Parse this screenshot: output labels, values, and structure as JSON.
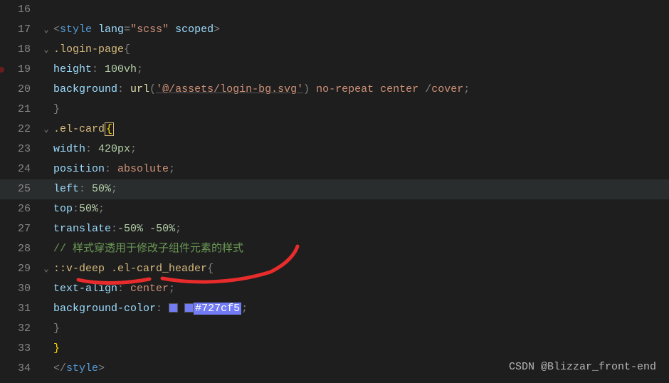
{
  "editor": {
    "lines": [
      {
        "num": 16,
        "fold": "",
        "tokens": []
      },
      {
        "num": 17,
        "fold": "v",
        "tokens": [
          {
            "t": "<",
            "c": "punct"
          },
          {
            "t": "style",
            "c": "tag"
          },
          {
            "t": " ",
            "c": ""
          },
          {
            "t": "lang",
            "c": "attr"
          },
          {
            "t": "=",
            "c": "punct"
          },
          {
            "t": "\"scss\"",
            "c": "str"
          },
          {
            "t": " ",
            "c": ""
          },
          {
            "t": "scoped",
            "c": "attr"
          },
          {
            "t": ">",
            "c": "punct"
          }
        ]
      },
      {
        "num": 18,
        "fold": "v",
        "indent": 1,
        "tokens": [
          {
            "t": ".login-page",
            "c": "sel"
          },
          {
            "t": "{",
            "c": "punct"
          }
        ]
      },
      {
        "num": 19,
        "fold": "",
        "indent": 2,
        "tokens": [
          {
            "t": "height",
            "c": "prop"
          },
          {
            "t": ": ",
            "c": "punct"
          },
          {
            "t": "100vh",
            "c": "num"
          },
          {
            "t": ";",
            "c": "punct"
          }
        ]
      },
      {
        "num": 20,
        "fold": "",
        "indent": 2,
        "tokens": [
          {
            "t": "background",
            "c": "prop"
          },
          {
            "t": ": ",
            "c": "punct"
          },
          {
            "t": "url",
            "c": "func"
          },
          {
            "t": "(",
            "c": "punct"
          },
          {
            "t": "'@/assets/login-bg.svg'",
            "c": "str-u"
          },
          {
            "t": ")",
            "c": "punct"
          },
          {
            "t": " ",
            "c": ""
          },
          {
            "t": "no-repeat",
            "c": "kw"
          },
          {
            "t": " ",
            "c": ""
          },
          {
            "t": "center",
            "c": "kw"
          },
          {
            "t": " /",
            "c": "punct"
          },
          {
            "t": "cover",
            "c": "kw"
          },
          {
            "t": ";",
            "c": "punct"
          }
        ]
      },
      {
        "num": 21,
        "fold": "",
        "indent": 1,
        "tokens": [
          {
            "t": "}",
            "c": "punct"
          }
        ]
      },
      {
        "num": 22,
        "fold": "v",
        "indent": 1,
        "tokens": [
          {
            "t": ".el-card",
            "c": "sel"
          },
          {
            "t": "{",
            "c": "cursor-box"
          }
        ]
      },
      {
        "num": 23,
        "fold": "",
        "indent": 2,
        "tokens": [
          {
            "t": "width",
            "c": "prop"
          },
          {
            "t": ": ",
            "c": "punct"
          },
          {
            "t": "420px",
            "c": "num"
          },
          {
            "t": ";",
            "c": "punct"
          }
        ]
      },
      {
        "num": 24,
        "fold": "",
        "indent": 2,
        "tokens": [
          {
            "t": "position",
            "c": "prop"
          },
          {
            "t": ": ",
            "c": "punct"
          },
          {
            "t": "absolute",
            "c": "kw"
          },
          {
            "t": ";",
            "c": "punct"
          }
        ]
      },
      {
        "num": 25,
        "fold": "",
        "indent": 2,
        "current": true,
        "tokens": [
          {
            "t": "left",
            "c": "prop"
          },
          {
            "t": ": ",
            "c": "punct"
          },
          {
            "t": "50%",
            "c": "num"
          },
          {
            "t": ";",
            "c": "punct"
          }
        ]
      },
      {
        "num": 26,
        "fold": "",
        "indent": 2,
        "tokens": [
          {
            "t": "top",
            "c": "prop"
          },
          {
            "t": ":",
            "c": "punct"
          },
          {
            "t": "50%",
            "c": "num"
          },
          {
            "t": ";",
            "c": "punct"
          }
        ]
      },
      {
        "num": 27,
        "fold": "",
        "indent": 2,
        "tokens": [
          {
            "t": "translate",
            "c": "prop"
          },
          {
            "t": ":",
            "c": "punct"
          },
          {
            "t": "-50%",
            "c": "num"
          },
          {
            "t": " ",
            "c": ""
          },
          {
            "t": "-50%",
            "c": "num"
          },
          {
            "t": ";",
            "c": "punct"
          }
        ]
      },
      {
        "num": 28,
        "fold": "",
        "indent": 2,
        "tokens": [
          {
            "t": "// 样式穿透用于修改子组件元素的样式",
            "c": "comment"
          }
        ]
      },
      {
        "num": 29,
        "fold": "v",
        "indent": 2,
        "tokens": [
          {
            "t": "::v-deep",
            "c": "sel"
          },
          {
            "t": " ",
            "c": ""
          },
          {
            "t": ".el-card_header",
            "c": "sel"
          },
          {
            "t": "{",
            "c": "punct"
          }
        ]
      },
      {
        "num": 30,
        "fold": "",
        "indent": 3,
        "tokens": [
          {
            "t": "text-align",
            "c": "prop"
          },
          {
            "t": ": ",
            "c": "punct"
          },
          {
            "t": "center",
            "c": "kw"
          },
          {
            "t": ";",
            "c": "punct"
          }
        ]
      },
      {
        "num": 31,
        "fold": "",
        "indent": 3,
        "tokens": [
          {
            "t": "background-color",
            "c": "prop"
          },
          {
            "t": ":  ",
            "c": "punct"
          },
          {
            "t": "",
            "c": "swatch"
          },
          {
            "t": " ",
            "c": ""
          },
          {
            "t": "",
            "c": "swatch"
          },
          {
            "t": "#727cf5",
            "c": "hexval"
          },
          {
            "t": ";",
            "c": "punct"
          }
        ]
      },
      {
        "num": 32,
        "fold": "",
        "indent": 2,
        "tokens": [
          {
            "t": "}",
            "c": "punct"
          }
        ]
      },
      {
        "num": 33,
        "fold": "",
        "indent": 1,
        "tokens": [
          {
            "t": "}",
            "c": "brace-match"
          }
        ]
      },
      {
        "num": 34,
        "fold": "",
        "indent": 0,
        "tokens": [
          {
            "t": "</",
            "c": "punct"
          },
          {
            "t": "style",
            "c": "tag"
          },
          {
            "t": ">",
            "c": "punct"
          }
        ]
      }
    ]
  },
  "breakpoint_row": 19,
  "watermark": "CSDN @Blizzar_front-end",
  "annotation_label": "hand-drawn-red-marks"
}
